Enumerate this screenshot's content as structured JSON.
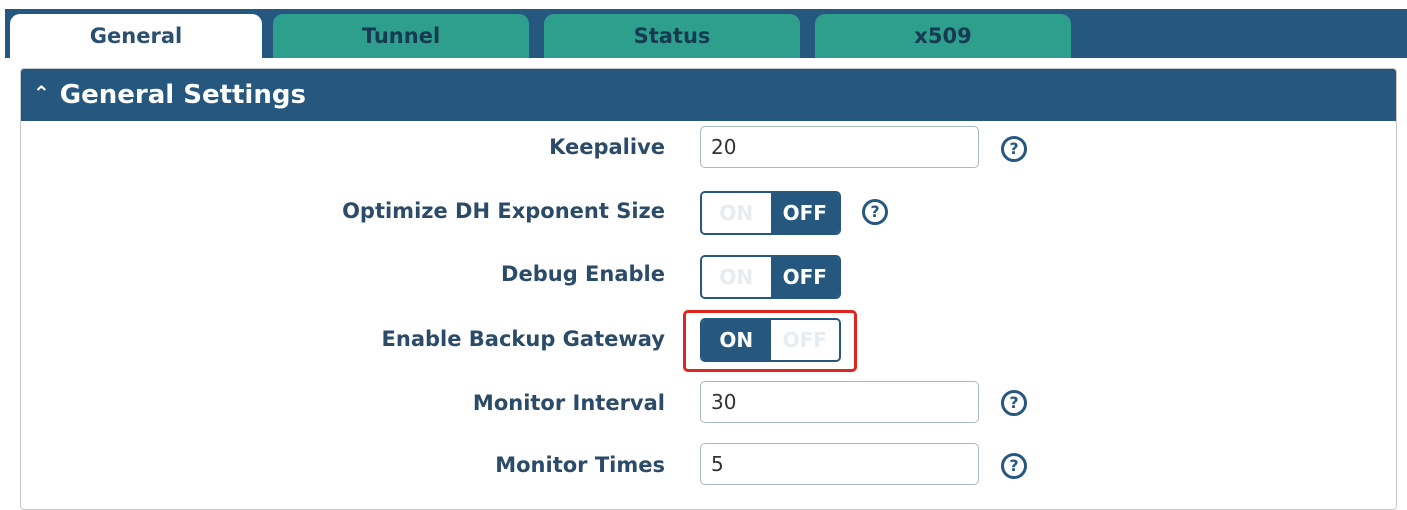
{
  "tabs": [
    {
      "label": "General",
      "active": true
    },
    {
      "label": "Tunnel",
      "active": false
    },
    {
      "label": "Status",
      "active": false
    },
    {
      "label": "x509",
      "active": false
    }
  ],
  "panel": {
    "title": "General Settings",
    "collapse_icon": "chevron-up-icon"
  },
  "fields": {
    "keepalive": {
      "label": "Keepalive",
      "value": "20"
    },
    "optimize_dh": {
      "label": "Optimize DH Exponent Size",
      "on_text": "ON",
      "off_text": "OFF",
      "state": "off"
    },
    "debug_enable": {
      "label": "Debug Enable",
      "on_text": "ON",
      "off_text": "OFF",
      "state": "off"
    },
    "backup_gateway": {
      "label": "Enable Backup Gateway",
      "on_text": "ON",
      "off_text": "OFF",
      "state": "on"
    },
    "monitor_interval": {
      "label": "Monitor Interval",
      "value": "30"
    },
    "monitor_times": {
      "label": "Monitor Times",
      "value": "5"
    }
  },
  "help_icon": {
    "glyph": "?",
    "name": "help-icon"
  },
  "colors": {
    "primary": "#26587f",
    "tab_inactive": "#2e9f8d",
    "highlight": "#e0241f"
  }
}
